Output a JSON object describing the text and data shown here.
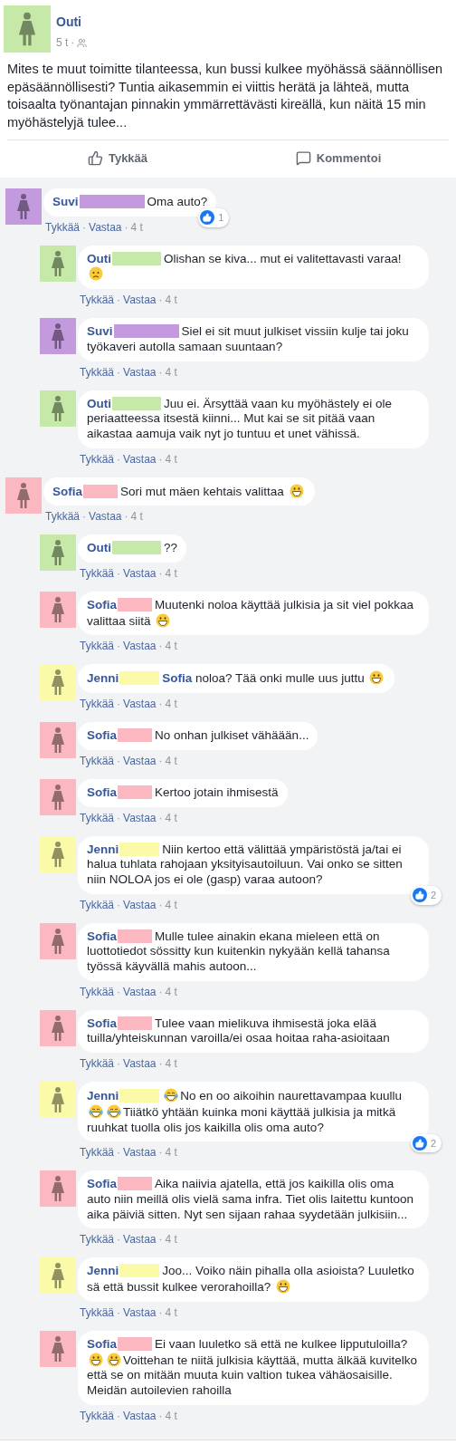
{
  "post": {
    "author": "Outi",
    "color": "#c6e8a8",
    "time": "5 t",
    "separator": "·",
    "text": "Mites te muut toimitte tilanteessa, kun bussi kulkee myöhässä säännöllisen epäsäännöllisesti? Tuntia aikasemmin ei viittis herätä ja lähteä, mutta toisaalta työnantajan pinnakin ymmärrettävästi kireällä, kun näitä 15 min myöhästelyjä tulee...",
    "actions": [
      {
        "kind": "like",
        "label": "Tykkää"
      },
      {
        "kind": "comment",
        "label": "Kommentoi"
      }
    ]
  },
  "comments": [
    {
      "author": "Suvi",
      "color": "#c39ade",
      "message": [
        {
          "kind": "text",
          "text": "Oma auto?"
        }
      ],
      "likes": "1",
      "meta": [
        "Tykkää",
        "·",
        "Vastaa",
        "·",
        "4 t"
      ],
      "children": [
        {
          "author": "Outi",
          "color": "#c6e8a8",
          "message": [
            {
              "kind": "text",
              "text": "Olishan se kiva... mut ei valitettavasti varaa!"
            },
            {
              "kind": "worried"
            }
          ],
          "meta": [
            "Tykkää",
            "·",
            "Vastaa",
            "·",
            "4 t"
          ]
        },
        {
          "author": "Suvi",
          "color": "#c39ade",
          "message": [
            {
              "kind": "text",
              "text": "Siel ei sit muut julkiset vissiin kulje tai joku työkaveri autolla samaan suuntaan?"
            }
          ],
          "meta": [
            "Tykkää",
            "·",
            "Vastaa",
            "·",
            "4 t"
          ]
        },
        {
          "author": "Outi",
          "color": "#c6e8a8",
          "message": [
            {
              "kind": "text",
              "text": "Juu ei. Ärsyttää vaan ku myöhästely ei ole periaatteessa itsestä kiinni... Mut kai se sit pitää vaan aikastaa aamuja vaik nyt jo tuntuu et unet vähissä."
            }
          ],
          "meta": [
            "Tykkää",
            "·",
            "Vastaa",
            "·",
            "4 t"
          ]
        }
      ]
    },
    {
      "author": "Sofia",
      "color": "#fbb8c0",
      "message": [
        {
          "kind": "text",
          "text": "Sori mut mäen kehtais valittaa"
        },
        {
          "kind": "grin"
        }
      ],
      "meta": [
        "Tykkää",
        "·",
        "Vastaa",
        "·",
        "4 t"
      ],
      "children": [
        {
          "author": "Outi",
          "color": "#c6e8a8",
          "message": [
            {
              "kind": "text",
              "text": "??"
            }
          ],
          "meta": [
            "Tykkää",
            "·",
            "Vastaa",
            "·",
            "4 t"
          ]
        },
        {
          "author": "Sofia",
          "color": "#fbb8c0",
          "message": [
            {
              "kind": "text",
              "text": "Muutenki noloa käyttää julkisia ja sit viel pokkaa valittaa siitä"
            },
            {
              "kind": "grin"
            }
          ],
          "meta": [
            "Tykkää",
            "·",
            "Vastaa",
            "·",
            "4 t"
          ]
        },
        {
          "author": "Jenni",
          "color": "#fbfaa8",
          "message": [
            {
              "kind": "mention",
              "text": "Sofia"
            },
            {
              "kind": "text",
              "text": "noloa? Tää onki mulle uus juttu"
            },
            {
              "kind": "grin"
            }
          ],
          "meta": [
            "Tykkää",
            "·",
            "Vastaa",
            "·",
            "4 t"
          ]
        },
        {
          "author": "Sofia",
          "color": "#fbb8c0",
          "message": [
            {
              "kind": "text",
              "text": "No onhan julkiset vähäään..."
            }
          ],
          "meta": [
            "Tykkää",
            "·",
            "Vastaa",
            "·",
            "4 t"
          ]
        },
        {
          "author": "Sofia",
          "color": "#fbb8c0",
          "message": [
            {
              "kind": "text",
              "text": "Kertoo jotain ihmisestä"
            }
          ],
          "meta": [
            "Tykkää",
            "·",
            "Vastaa",
            "·",
            "4 t"
          ]
        },
        {
          "author": "Jenni",
          "color": "#fbfaa8",
          "message": [
            {
              "kind": "text",
              "text": "Niin kertoo että välittää ympäristöstä ja/tai ei halua tuhlata rahojaan yksityisautoiluun. Vai onko se sitten niin NOLOA jos ei ole (gasp) varaa autoon?"
            }
          ],
          "likes": "2",
          "meta": [
            "Tykkää",
            "·",
            "Vastaa",
            "·",
            "4 t"
          ]
        },
        {
          "author": "Sofia",
          "color": "#fbb8c0",
          "message": [
            {
              "kind": "text",
              "text": "Mulle tulee ainakin ekana mieleen että on luottotiedot sössitty kun kuitenkin nykyään kellä tahansa työssä käyvällä mahis autoon..."
            }
          ],
          "meta": [
            "Tykkää",
            "·",
            "Vastaa",
            "·",
            "4 t"
          ]
        },
        {
          "author": "Sofia",
          "color": "#fbb8c0",
          "message": [
            {
              "kind": "text",
              "text": "Tulee vaan mielikuva ihmisestä joka elää tuilla/yhteiskunnan varoilla/ei osaa hoitaa raha-asioitaan"
            }
          ],
          "meta": [
            "Tykkää",
            "·",
            "Vastaa",
            "·",
            "4 t"
          ]
        },
        {
          "author": "Jenni",
          "color": "#fbfaa8",
          "message": [
            {
              "kind": "joy"
            },
            {
              "kind": "text",
              "text": "No en oo aikoihin naurettavampaa kuullu"
            },
            {
              "kind": "joy"
            },
            {
              "kind": "joy"
            },
            {
              "kind": "text",
              "text": "Tiiätkö yhtään kuinka moni käyttää julkisia ja mitkä ruuhkat tuolla olis jos kaikilla olis oma auto?"
            }
          ],
          "likes": "2",
          "meta": [
            "Tykkää",
            "·",
            "Vastaa",
            "·",
            "4 t"
          ]
        },
        {
          "author": "Sofia",
          "color": "#fbb8c0",
          "message": [
            {
              "kind": "text",
              "text": "Aika naiivia ajatella, että jos kaikilla olis oma auto niin meillä olis vielä sama infra. Tiet olis laitettu kuntoon aika päiviä sitten. Nyt sen sijaan rahaa syydetään julkisiin..."
            }
          ],
          "meta": [
            "Tykkää",
            "·",
            "Vastaa",
            "·",
            "4 t"
          ]
        },
        {
          "author": "Jenni",
          "color": "#fbfaa8",
          "message": [
            {
              "kind": "text",
              "text": "Joo... Voiko näin pihalla olla asioista? Luuletko sä että bussit kulkee verorahoilla?"
            },
            {
              "kind": "grin"
            }
          ],
          "meta": [
            "Tykkää",
            "·",
            "Vastaa",
            "·",
            "4 t"
          ]
        },
        {
          "author": "Sofia",
          "color": "#fbb8c0",
          "message": [
            {
              "kind": "text",
              "text": "Ei vaan luuletko sä että ne kulkee lipputuloilla?"
            },
            {
              "kind": "grin"
            },
            {
              "kind": "grin"
            },
            {
              "kind": "text",
              "text": "Voittehan te niitä julkisia käyttää, mutta älkää kuvitelko että se on mitään muuta kuin valtion tukea vähäosaisille. Meidän autoilevien rahoilla"
            }
          ],
          "meta": [
            "Tykkää",
            "·",
            "Vastaa",
            "·",
            "4 t"
          ]
        }
      ]
    }
  ]
}
